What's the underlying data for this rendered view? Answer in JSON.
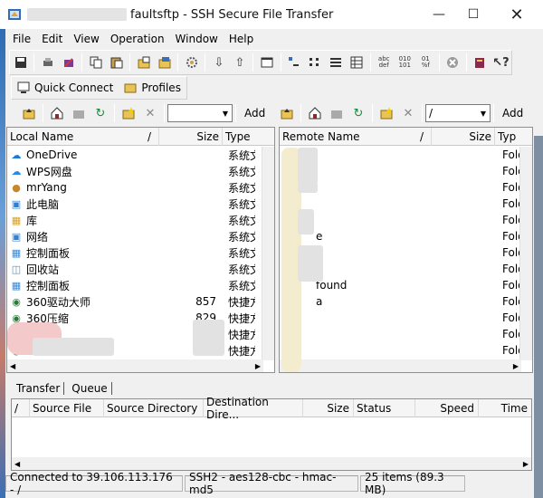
{
  "window": {
    "title": "faultsftp - SSH Secure File Transfer"
  },
  "menu": [
    "File",
    "Edit",
    "View",
    "Operation",
    "Window",
    "Help"
  ],
  "quick": {
    "connect": "Quick Connect",
    "profiles": "Profiles"
  },
  "local": {
    "path_value": "",
    "add_label": "Add",
    "headers": {
      "name": "Local Name",
      "sort": "/",
      "size": "Size",
      "type": "Type"
    },
    "rows": [
      {
        "icon": "onedrive-icon",
        "name": "OneDrive",
        "size": "",
        "type": "系统文"
      },
      {
        "icon": "wps-cloud-icon",
        "name": "WPS网盘",
        "size": "",
        "type": "系统文"
      },
      {
        "icon": "user-icon",
        "name": "mrYang",
        "size": "",
        "type": "系统文"
      },
      {
        "icon": "computer-icon",
        "name": "此电脑",
        "size": "",
        "type": "系统文"
      },
      {
        "icon": "library-icon",
        "name": "库",
        "size": "",
        "type": "系统文"
      },
      {
        "icon": "network-icon",
        "name": "网络",
        "size": "",
        "type": "系统文"
      },
      {
        "icon": "control-panel-icon",
        "name": "控制面板",
        "size": "",
        "type": "系统文"
      },
      {
        "icon": "recycle-bin-icon",
        "name": "回收站",
        "size": "",
        "type": "系统文"
      },
      {
        "icon": "control-panel-icon",
        "name": "控制面板",
        "size": "",
        "type": "系统文"
      },
      {
        "icon": "app-icon",
        "name": "360驱动大师",
        "size": "857",
        "type": "快捷方"
      },
      {
        "icon": "app-icon",
        "name": "360压缩",
        "size": "829",
        "type": "快捷方"
      },
      {
        "icon": "app-icon",
        "name": "",
        "size": "",
        "type": "快捷方"
      },
      {
        "icon": "app-icon",
        "name": "",
        "size": "",
        "type": "快捷方"
      }
    ]
  },
  "remote": {
    "path_value": "/",
    "add_label": "Add",
    "headers": {
      "name": "Remote Name",
      "sort": "/",
      "size": "Size",
      "type": "Typ"
    },
    "rows": [
      {
        "name": "",
        "type": "Fold"
      },
      {
        "name": "",
        "type": "Fold"
      },
      {
        "name": "",
        "type": "Fold"
      },
      {
        "name": "",
        "type": "Fold"
      },
      {
        "name": "",
        "type": "Fold"
      },
      {
        "name": "e",
        "type": "Fold"
      },
      {
        "name": "",
        "type": "Fold"
      },
      {
        "name": "",
        "type": "Fold"
      },
      {
        "name": "found",
        "type": "Fold"
      },
      {
        "name": "a",
        "type": "Fold"
      },
      {
        "name": "",
        "type": "Fold"
      },
      {
        "name": "",
        "type": "Fold"
      },
      {
        "name": "",
        "type": "Fold"
      }
    ]
  },
  "transfer": {
    "tabs": [
      "Transfer",
      "Queue"
    ],
    "headers": {
      "sort": "/",
      "source_file": "Source File",
      "source_dir": "Source Directory",
      "dest_dir": "Destination Dire...",
      "size": "Size",
      "status": "Status",
      "speed": "Speed",
      "time": "Time"
    }
  },
  "status": {
    "connection": "Connected to 39.106.113.176 - /",
    "cipher": "SSH2 - aes128-cbc - hmac-md5",
    "items": "25 items (89.3 MB)"
  }
}
